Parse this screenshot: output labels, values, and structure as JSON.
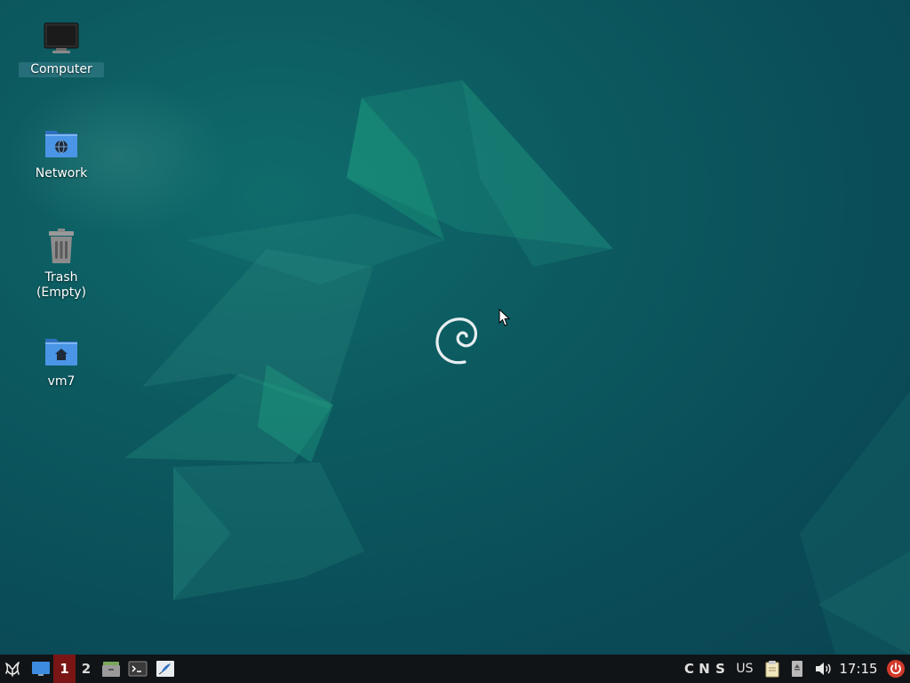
{
  "desktop": {
    "icons": [
      {
        "label": "Computer",
        "icon": "computer-icon"
      },
      {
        "label": "Network",
        "icon": "network-folder-icon"
      },
      {
        "label": "Trash\n(Empty)",
        "label_line1": "Trash",
        "label_line2": "(Empty)",
        "icon": "trash-icon"
      },
      {
        "label": "vm7",
        "icon": "home-folder-icon"
      }
    ]
  },
  "taskbar": {
    "workspaces": [
      "1",
      "2"
    ],
    "active_workspace": "1",
    "indicators": {
      "caps": "C",
      "num": "N",
      "scroll": "S"
    },
    "keyboard_layout": "US",
    "clock": "17:15"
  },
  "colors": {
    "taskbar_bg": "#111416",
    "active_workspace": "#7a1515",
    "power_button": "#d33a2c",
    "folder_blue": "#3d8be0"
  }
}
